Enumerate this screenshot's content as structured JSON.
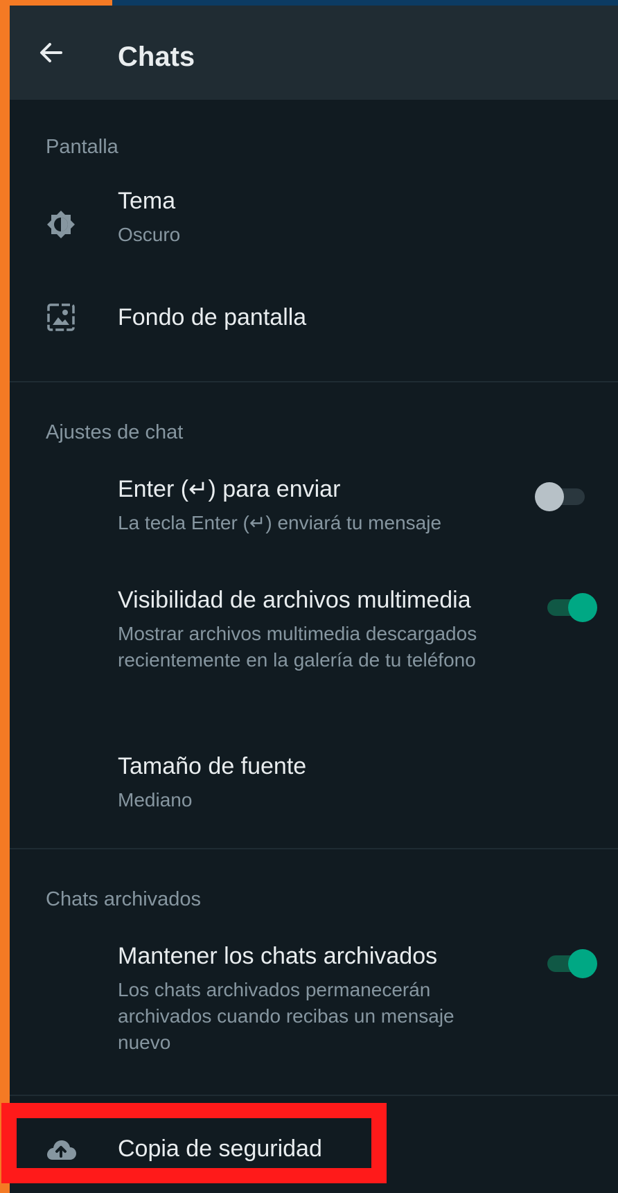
{
  "header": {
    "title": "Chats",
    "back_icon": "arrow-back-icon"
  },
  "sections": {
    "display": {
      "header": "Pantalla",
      "theme": {
        "title": "Tema",
        "subtitle": "Oscuro",
        "icon": "brightness-icon"
      },
      "wallpaper": {
        "title": "Fondo de pantalla",
        "icon": "wallpaper-icon"
      }
    },
    "chat_settings": {
      "header": "Ajustes de chat",
      "enter_to_send": {
        "title": "Enter (↵) para enviar",
        "subtitle": "La tecla Enter (↵) enviará tu mensaje",
        "enabled": false
      },
      "media_visibility": {
        "title": "Visibilidad de archivos multimedia",
        "subtitle": "Mostrar archivos multimedia descargados recientemente en la galería de tu teléfono",
        "enabled": true
      },
      "font_size": {
        "title": "Tamaño de fuente",
        "subtitle": "Mediano"
      }
    },
    "archived": {
      "header": "Chats archivados",
      "keep_archived": {
        "title": "Mantener los chats archivados",
        "subtitle": "Los chats archivados permanecerán archivados cuando recibas un mensaje nuevo",
        "enabled": true
      }
    },
    "backup": {
      "title": "Copia de seguridad",
      "icon": "cloud-upload-icon"
    }
  },
  "colors": {
    "background": "#111b21",
    "appbar": "#202c33",
    "accent_green": "#00a884",
    "secondary_text": "#8696a0",
    "primary_text": "#e9edef",
    "frame_orange": "#f47a24",
    "highlight_red": "#ff1a1a"
  }
}
